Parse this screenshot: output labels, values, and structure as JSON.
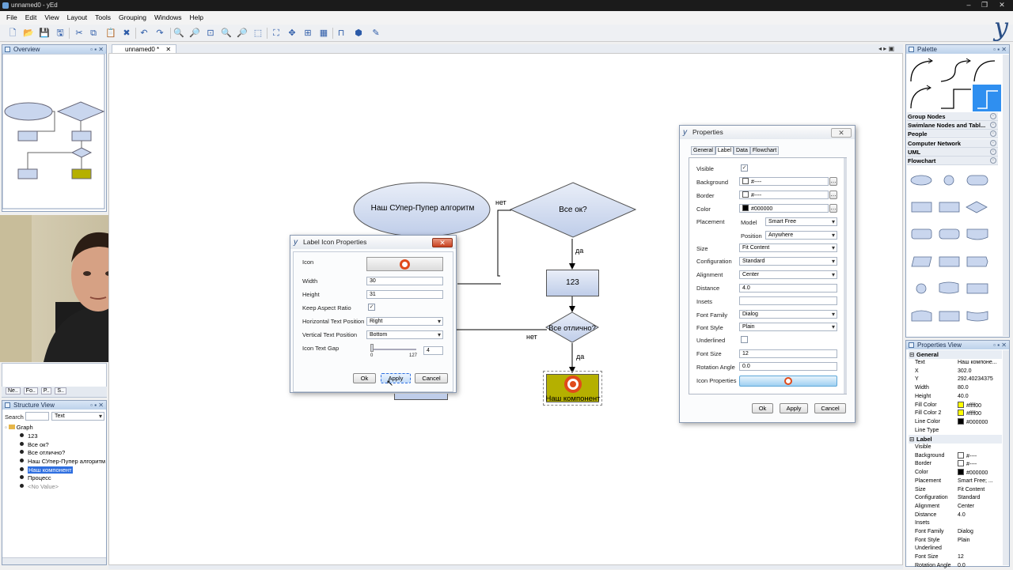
{
  "window": {
    "title": "unnamed0 - yEd",
    "buttons": [
      "–",
      "❐",
      "✕"
    ]
  },
  "menu": [
    "File",
    "Edit",
    "View",
    "Layout",
    "Tools",
    "Grouping",
    "Windows",
    "Help"
  ],
  "toolbar_icons": [
    "new-icon",
    "open-icon",
    "save-icon",
    "save-as-icon",
    "cut-icon",
    "copy-icon",
    "paste-icon",
    "delete-icon",
    "undo-icon",
    "redo-icon",
    "zoom-in-icon",
    "zoom-out-icon",
    "zoom-fit-icon",
    "zoom-in2-icon",
    "zoom-out2-icon",
    "zoom-area-icon",
    "fit-content-icon",
    "navigate-icon",
    "snap-icon",
    "grid-icon",
    "bridge-icon",
    "group-icon",
    "wizard-icon"
  ],
  "toolbar_glyphs": [
    "🗋",
    "📂",
    "💾",
    "🖫",
    "✂",
    "⧉",
    "📋",
    "✖",
    "↶",
    "↷",
    "🔍",
    "🔎",
    "⊡",
    "🔍",
    "🔎",
    "⬚",
    "⛶",
    "✥",
    "⊞",
    "▦",
    "⊓",
    "⬢",
    "✎"
  ],
  "overview": {
    "title": "Overview"
  },
  "doc_tab": {
    "label": "unnamed0 *"
  },
  "side_tabs": [
    "Ne..",
    "Fo..",
    "P..",
    "S.."
  ],
  "structure": {
    "title": "Structure View",
    "search_label": "Search",
    "search_value": "",
    "mode": "Text",
    "root": "Graph",
    "items": [
      "123",
      "Все ок?",
      "Все отлично?",
      "Наш СУпер-Пупер алгоритм",
      "Наш компонент",
      "Процесс",
      "<No Value>"
    ],
    "selected": "Наш компонент"
  },
  "graph": {
    "ellipse": "Наш СУпер-Пупер алгоритм",
    "diamond1": "Все ок?",
    "box123": "123",
    "diamond2": "Все отлично?",
    "component": "Наш компонент",
    "edge_no1": "нет",
    "edge_yes1": "да",
    "edge_no2": "нет",
    "edge_yes2": "да"
  },
  "label_icon_dialog": {
    "title": "Label Icon Properties",
    "icon_label": "Icon",
    "width_label": "Width",
    "width": "30",
    "height_label": "Height",
    "height": "31",
    "keep_aspect_label": "Keep Aspect Ratio",
    "keep_aspect": true,
    "htp_label": "Horizontal Text Position",
    "htp": "Right",
    "vtp_label": "Vertical Text Position",
    "vtp": "Bottom",
    "gap_label": "Icon Text Gap",
    "gap": "4",
    "gap_min": "0",
    "gap_max": "127",
    "ok": "Ok",
    "apply": "Apply",
    "cancel": "Cancel"
  },
  "properties_dialog": {
    "title": "Properties",
    "tabs": [
      "General",
      "Label",
      "Data",
      "Flowchart"
    ],
    "active_tab": "Label",
    "rows": {
      "visible": "Visible",
      "background": "Background",
      "background_val": "#----",
      "border": "Border",
      "border_val": "#----",
      "color": "Color",
      "color_val": "#000000",
      "placement": "Placement",
      "model_label": "Model",
      "model": "Smart Free",
      "position_label": "Position",
      "position": "Anywhere",
      "size": "Size",
      "size_val": "Fit Content",
      "configuration": "Configuration",
      "configuration_val": "Standard",
      "alignment": "Alignment",
      "alignment_val": "Center",
      "distance": "Distance",
      "distance_val": "4.0",
      "insets": "Insets",
      "insets_val": "",
      "font_family": "Font Family",
      "font_family_val": "Dialog",
      "font_style": "Font Style",
      "font_style_val": "Plain",
      "underlined": "Underlined",
      "font_size": "Font Size",
      "font_size_val": "12",
      "rotation": "Rotation Angle",
      "rotation_val": "0.0",
      "icon_props": "Icon Properties"
    },
    "ok": "Ok",
    "apply": "Apply",
    "cancel": "Cancel"
  },
  "palette": {
    "title": "Palette",
    "sections": [
      "Group Nodes",
      "Swimlane Nodes and Tabl...",
      "People",
      "Computer Network",
      "UML",
      "Flowchart"
    ]
  },
  "properties_view": {
    "title": "Properties View",
    "general": "General",
    "general_rows": [
      {
        "k": "Text",
        "v": "Наш компоне..."
      },
      {
        "k": "X",
        "v": "302.0"
      },
      {
        "k": "Y",
        "v": "292.40234375"
      },
      {
        "k": "Width",
        "v": "80.0"
      },
      {
        "k": "Height",
        "v": "40.0"
      },
      {
        "k": "Fill Color",
        "v": "#ffff00"
      },
      {
        "k": "Fill Color 2",
        "v": "#ffff00"
      },
      {
        "k": "Line Color",
        "v": "#000000"
      },
      {
        "k": "Line Type",
        "v": ""
      }
    ],
    "label": "Label",
    "label_rows": [
      {
        "k": "Visible",
        "v": ""
      },
      {
        "k": "Background",
        "v": "#----"
      },
      {
        "k": "Border",
        "v": "#----"
      },
      {
        "k": "Color",
        "v": "#000000"
      },
      {
        "k": "Placement",
        "v": "Smart Free; ..."
      },
      {
        "k": "Size",
        "v": "Fit Content"
      },
      {
        "k": "Configuration",
        "v": "Standard"
      },
      {
        "k": "Alignment",
        "v": "Center"
      },
      {
        "k": "Distance",
        "v": "4.0"
      },
      {
        "k": "Insets",
        "v": ""
      },
      {
        "k": "Font Family",
        "v": "Dialog"
      },
      {
        "k": "Font Style",
        "v": "Plain"
      },
      {
        "k": "Underlined",
        "v": ""
      },
      {
        "k": "Font Size",
        "v": "12"
      },
      {
        "k": "Rotation Angle",
        "v": "0.0"
      }
    ]
  },
  "colors": {
    "node_fill": "#c9d6ee",
    "component_fill": "#b5b000",
    "accent": "#2f6fe0",
    "icon_ring": "#e04a1a"
  }
}
